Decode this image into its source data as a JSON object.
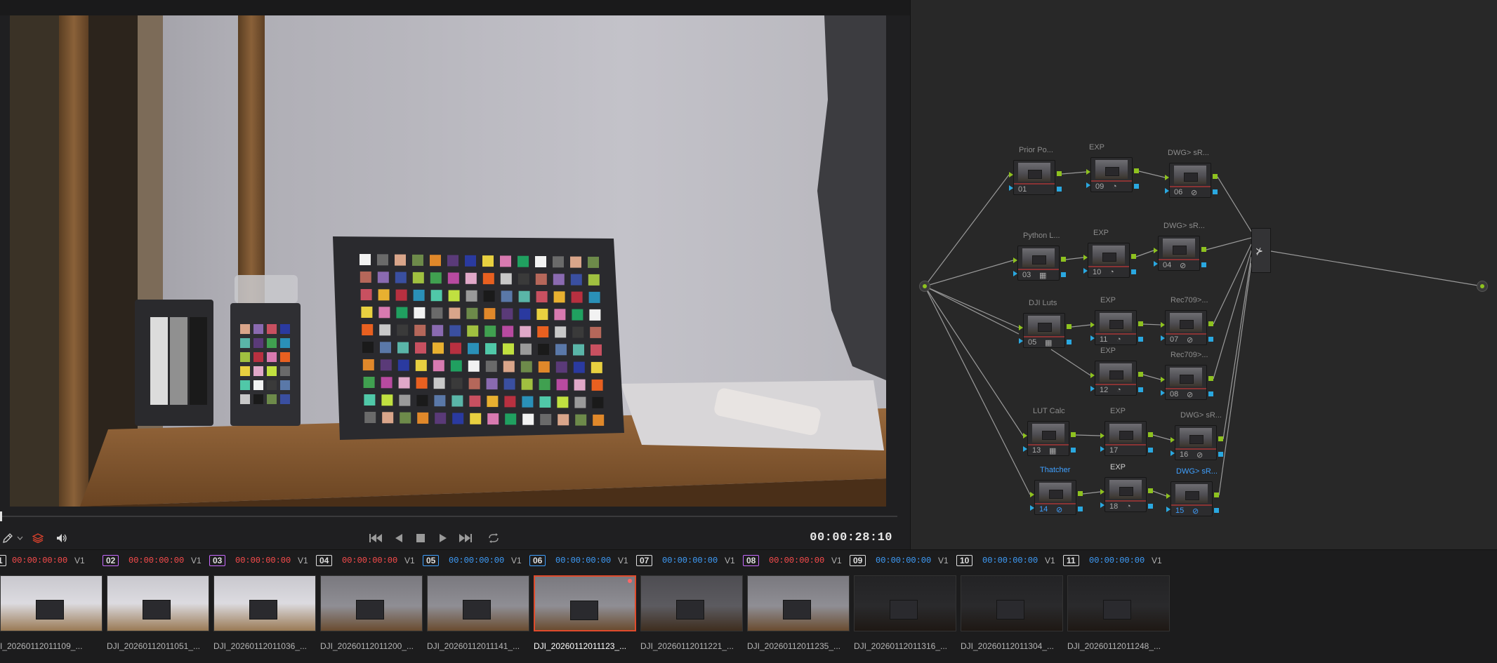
{
  "viewer": {
    "timecode": "00:00:28:10"
  },
  "transport": {
    "icons": [
      "eyedropper-icon",
      "chevron-down-icon",
      "layers-icon",
      "speaker-icon",
      "skip-back-icon",
      "step-back-icon",
      "stop-icon",
      "play-icon",
      "skip-forward-icon",
      "loop-icon"
    ]
  },
  "node_editor": {
    "nodes": [
      {
        "id": "01",
        "label": "Prior Po...",
        "icon": ""
      },
      {
        "id": "09",
        "label": "EXP",
        "icon": "magic-mask-icon"
      },
      {
        "id": "06",
        "label": "DWG> sR...",
        "icon": "circle-icon"
      },
      {
        "id": "03",
        "label": "Python L...",
        "icon": "grid-icon"
      },
      {
        "id": "10",
        "label": "EXP",
        "icon": "magic-mask-icon"
      },
      {
        "id": "04",
        "label": "DWG> sR...",
        "icon": "circle-icon"
      },
      {
        "id": "05",
        "label": "DJI Luts",
        "icon": "grid-icon"
      },
      {
        "id": "11",
        "label": "EXP",
        "icon": "magic-mask-icon"
      },
      {
        "id": "07",
        "label": "Rec709>...",
        "icon": "circle-icon"
      },
      {
        "id": "12",
        "label": "EXP",
        "icon": "magic-mask-icon"
      },
      {
        "id": "08",
        "label": "Rec709>...",
        "icon": "circle-icon"
      },
      {
        "id": "13",
        "label": "LUT Calc",
        "icon": "grid-icon"
      },
      {
        "id": "17",
        "label": "EXP",
        "icon": ""
      },
      {
        "id": "16",
        "label": "DWG> sR...",
        "icon": "circle-icon"
      },
      {
        "id": "14",
        "label": "Thatcher",
        "icon": "circle-icon"
      },
      {
        "id": "18",
        "label": "EXP",
        "icon": "magic-mask-icon"
      },
      {
        "id": "15",
        "label": "DWG> sR...",
        "icon": "circle-icon"
      }
    ]
  },
  "timeline": {
    "clips": [
      {
        "num": "1",
        "tc": "00:00:00:00",
        "tc_color": "#ff4d4d",
        "track": "V1",
        "name": "I_20260112011109_...",
        "num_color": "#e0e0e0",
        "tone": "bright"
      },
      {
        "num": "02",
        "tc": "00:00:00:00",
        "tc_color": "#ff4d4d",
        "track": "V1",
        "name": "DJI_20260112011051_...",
        "num_color": "#c86bff",
        "tone": "bright"
      },
      {
        "num": "03",
        "tc": "00:00:00:00",
        "tc_color": "#ff4d4d",
        "track": "V1",
        "name": "DJI_20260112011036_...",
        "num_color": "#c86bff",
        "tone": "bright"
      },
      {
        "num": "04",
        "tc": "00:00:00:00",
        "tc_color": "#ff4d4d",
        "track": "V1",
        "name": "DJI_20260112011200_...",
        "num_color": "#e0e0e0",
        "tone": "mid"
      },
      {
        "num": "05",
        "tc": "00:00:00:00",
        "tc_color": "#3fa0ff",
        "track": "V1",
        "name": "DJI_20260112011141_...",
        "num_color": "#3fa0ff",
        "tone": "mid"
      },
      {
        "num": "06",
        "tc": "00:00:00:00",
        "tc_color": "#3fa0ff",
        "track": "V1",
        "name": "DJI_20260112011123_...",
        "num_color": "#3fa0ff",
        "tone": "mid",
        "selected": true
      },
      {
        "num": "07",
        "tc": "00:00:00:00",
        "tc_color": "#3fa0ff",
        "track": "V1",
        "name": "DJI_20260112011221_...",
        "num_color": "#e0e0e0",
        "tone": "dim"
      },
      {
        "num": "08",
        "tc": "00:00:00:00",
        "tc_color": "#ff4d4d",
        "track": "V1",
        "name": "DJI_20260112011235_...",
        "num_color": "#c86bff",
        "tone": "mid"
      },
      {
        "num": "09",
        "tc": "00:00:00:00",
        "tc_color": "#3fa0ff",
        "track": "V1",
        "name": "DJI_20260112011316_...",
        "num_color": "#e0e0e0",
        "tone": "dark"
      },
      {
        "num": "10",
        "tc": "00:00:00:00",
        "tc_color": "#3fa0ff",
        "track": "V1",
        "name": "DJI_20260112011304_...",
        "num_color": "#e0e0e0",
        "tone": "dark"
      },
      {
        "num": "11",
        "tc": "00:00:00:00",
        "tc_color": "#3fa0ff",
        "track": "V1",
        "name": "DJI_20260112011248_...",
        "num_color": "#e0e0e0",
        "tone": "dark"
      }
    ]
  }
}
